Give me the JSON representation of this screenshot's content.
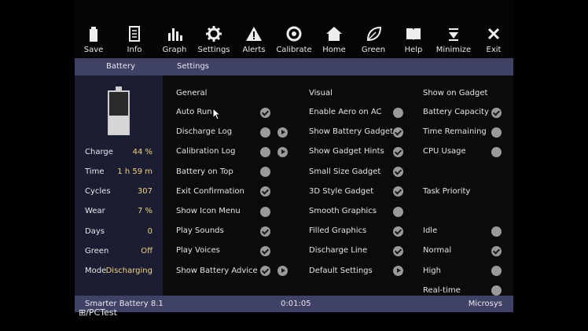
{
  "toolbar": [
    {
      "label": "Save",
      "icon": "battery-save-icon"
    },
    {
      "label": "Info",
      "icon": "info-icon"
    },
    {
      "label": "Graph",
      "icon": "graph-icon"
    },
    {
      "label": "Settings",
      "icon": "gear-icon"
    },
    {
      "label": "Alerts",
      "icon": "warning-icon"
    },
    {
      "label": "Calibrate",
      "icon": "target-icon"
    },
    {
      "label": "Home",
      "icon": "home-icon"
    },
    {
      "label": "Green",
      "icon": "leaf-icon"
    },
    {
      "label": "Help",
      "icon": "book-icon"
    },
    {
      "label": "Minimize",
      "icon": "minimize-icon"
    },
    {
      "label": "Exit",
      "icon": "close-icon"
    }
  ],
  "section": {
    "left": "Battery",
    "right": "Settings"
  },
  "battery": {
    "level_percent": 44,
    "stats": [
      {
        "key": "Charge",
        "value": "44 %"
      },
      {
        "key": "Time",
        "value": "1 h 59 m"
      },
      {
        "key": "Cycles",
        "value": "307"
      },
      {
        "key": "Wear",
        "value": "7 %"
      },
      {
        "key": "Days",
        "value": "0"
      },
      {
        "key": "Green",
        "value": "Off"
      },
      {
        "key": "Mode",
        "value": "Discharging"
      }
    ]
  },
  "settings": {
    "general": {
      "title": "General",
      "items": [
        {
          "label": "Auto Run",
          "checked": true,
          "play": false
        },
        {
          "label": "Discharge Log",
          "checked": false,
          "play": true
        },
        {
          "label": "Calibration Log",
          "checked": false,
          "play": true
        },
        {
          "label": "Battery on Top",
          "checked": false,
          "play": false
        },
        {
          "label": "Exit Confirmation",
          "checked": true,
          "play": false
        },
        {
          "label": "Show Icon Menu",
          "checked": false,
          "play": false
        },
        {
          "label": "Play Sounds",
          "checked": true,
          "play": false
        },
        {
          "label": "Play Voices",
          "checked": true,
          "play": false
        },
        {
          "label": "Show Battery Advice",
          "checked": true,
          "play": true
        }
      ]
    },
    "visual": {
      "title": "Visual",
      "items": [
        {
          "label": "Enable Aero on AC",
          "checked": false,
          "play": false
        },
        {
          "label": "Show Battery Gadget",
          "checked": true,
          "play": false
        },
        {
          "label": "Show Gadget Hints",
          "checked": true,
          "play": false
        },
        {
          "label": "Small Size Gadget",
          "checked": true,
          "play": false
        },
        {
          "label": "3D Style Gadget",
          "checked": true,
          "play": false
        },
        {
          "label": "Smooth Graphics",
          "checked": false,
          "play": false
        },
        {
          "label": "Filled Graphics",
          "checked": true,
          "play": false
        },
        {
          "label": "Discharge Line",
          "checked": true,
          "play": false
        },
        {
          "label": "Default Settings",
          "checked": null,
          "play": true
        }
      ]
    },
    "gadget": {
      "title": "Show on Gadget",
      "items": [
        {
          "label": "Battery Capacity",
          "checked": true
        },
        {
          "label": "Time Remaining",
          "checked": false
        },
        {
          "label": "CPU Usage",
          "checked": false
        }
      ]
    },
    "priority": {
      "title": "Task Priority",
      "items": [
        {
          "label": "Idle",
          "checked": false
        },
        {
          "label": "Normal",
          "checked": true
        },
        {
          "label": "High",
          "checked": false
        },
        {
          "label": "Real-time",
          "checked": false
        }
      ]
    }
  },
  "status": {
    "app": "Smarter Battery 8.1",
    "time": "0:01:05",
    "vendor": "Microsys"
  },
  "watermark": "/PCTest"
}
